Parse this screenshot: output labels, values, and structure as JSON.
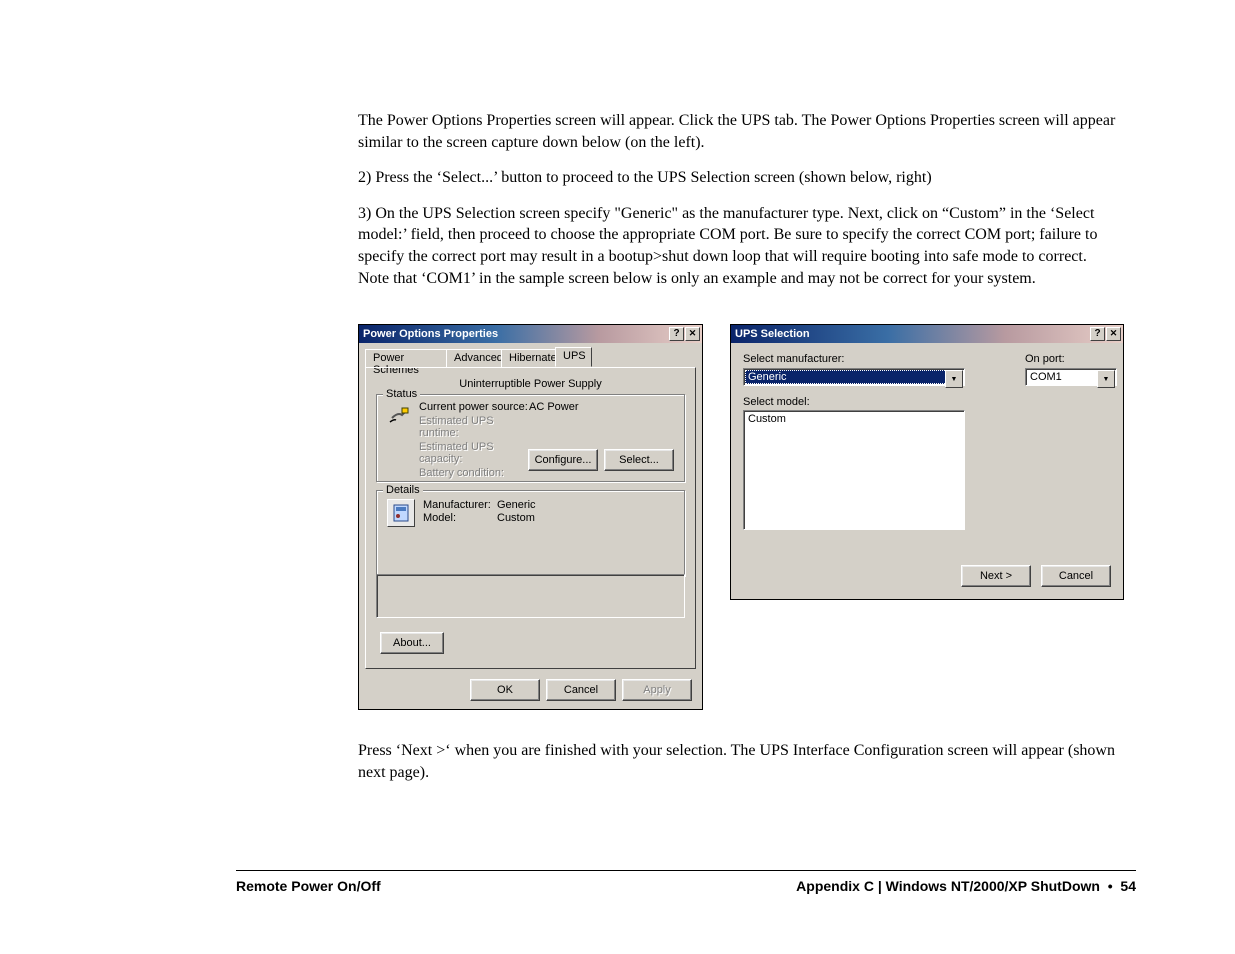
{
  "para1": "The Power Options Properties screen will appear.  Click the UPS tab.  The Power Options Properties screen will appear similar to the screen capture down below (on the left).",
  "para2": "2)  Press the ‘Select...’ button to proceed to the UPS Selection screen (shown below, right)",
  "para3": "3)   On the UPS Selection screen specify \"Generic\" as the manufacturer type.  Next, click on “Custom” in the ‘Select model:’ field, then proceed to choose the appropriate COM port.  Be sure to specify the correct COM port; failure to specify the correct port may result in a bootup>shut down loop that will require booting into safe mode to correct.  Note that ‘COM1’ in the sample screen below is only an example and may not be correct for your system.",
  "para4": "Press ‘Next >‘ when you are finished with your selection.  The UPS Interface Configuration screen will appear (shown next page).",
  "footer_left": "Remote Power On/Off",
  "footer_right_a": "Appendix C | Windows NT/2000/XP ShutDown",
  "footer_right_b": "54",
  "dlg1": {
    "title": "Power Options Properties",
    "tabs": {
      "t1": "Power Schemes",
      "t2": "Advanced",
      "t3": "Hibernate",
      "t4": "UPS"
    },
    "section_title": "Uninterruptible Power Supply",
    "status_legend": "Status",
    "status": {
      "l1": "Current power source:",
      "v1": "AC Power",
      "l2": "Estimated UPS runtime:",
      "l3": "Estimated UPS capacity:",
      "l4": "Battery condition:"
    },
    "details_legend": "Details",
    "details": {
      "l1": "Manufacturer:",
      "v1": "Generic",
      "l2": "Model:",
      "v2": "Custom"
    },
    "btn_configure": "Configure...",
    "btn_select": "Select...",
    "btn_about": "About...",
    "btn_ok": "OK",
    "btn_cancel": "Cancel",
    "btn_apply": "Apply"
  },
  "dlg2": {
    "title": "UPS Selection",
    "label_mfg": "Select manufacturer:",
    "label_port": "On port:",
    "mfg_value": "Generic",
    "port_value": "COM1",
    "label_model": "Select model:",
    "model_item": "Custom",
    "btn_next": "Next >",
    "btn_cancel": "Cancel"
  }
}
